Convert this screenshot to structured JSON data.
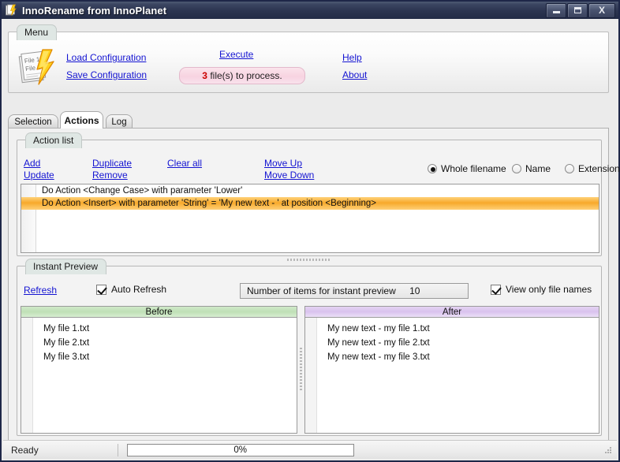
{
  "window": {
    "title": "InnoRename from InnoPlanet",
    "icon": "app-lightning-icon",
    "controls": {
      "minimize": "_",
      "maximize": "▭",
      "close": "X"
    }
  },
  "menu": {
    "caption": "Menu",
    "logo_lines": [
      "File 1",
      "File 2"
    ],
    "links": {
      "load_configuration": "Load Configuration",
      "save_configuration": "Save Configuration",
      "execute": "Execute",
      "help": "Help",
      "about": "About"
    },
    "file_count": "3",
    "file_count_suffix": "file(s) to process.",
    "accent_count_color": "#cc0000"
  },
  "tabs": [
    {
      "label": "Selection",
      "active": false
    },
    {
      "label": "Actions",
      "active": true
    },
    {
      "label": "Log",
      "active": false
    }
  ],
  "action_list": {
    "caption": "Action list",
    "links": {
      "add": "Add",
      "update": "Update",
      "duplicate": "Duplicate",
      "remove": "Remove",
      "clear_all": "Clear all",
      "move_up": "Move Up",
      "move_down": "Move Down"
    },
    "scope_options": [
      {
        "label": "Whole filename",
        "selected": true
      },
      {
        "label": "Name",
        "selected": false
      },
      {
        "label": "Extension",
        "selected": false
      }
    ],
    "rows": [
      {
        "text": "Do Action <Change Case> with parameter 'Lower'",
        "selected": false
      },
      {
        "text": "Do Action <Insert> with parameter 'String'  = 'My new text - ' at position <Beginning>",
        "selected": true
      }
    ],
    "selection_color": "#f7a92b"
  },
  "instant_preview": {
    "caption": "Instant Preview",
    "refresh_link": "Refresh",
    "auto_refresh": {
      "label": "Auto Refresh",
      "checked": true
    },
    "items_field": {
      "label": "Number of items for instant preview",
      "value": "10"
    },
    "view_only_file_names": {
      "label": "View only file names",
      "checked": true
    },
    "before": {
      "header": "Before",
      "header_color": "#bfe0b6",
      "items": [
        "My file 1.txt",
        "My file 2.txt",
        "My file 3.txt"
      ]
    },
    "after": {
      "header": "After",
      "header_color": "#d9c2ee",
      "items": [
        "My new text - my file 1.txt",
        "My new text - my file 2.txt",
        "My new text - my file 3.txt"
      ]
    }
  },
  "status_bar": {
    "status": "Ready",
    "progress_label": "0%",
    "progress_value": 0
  }
}
